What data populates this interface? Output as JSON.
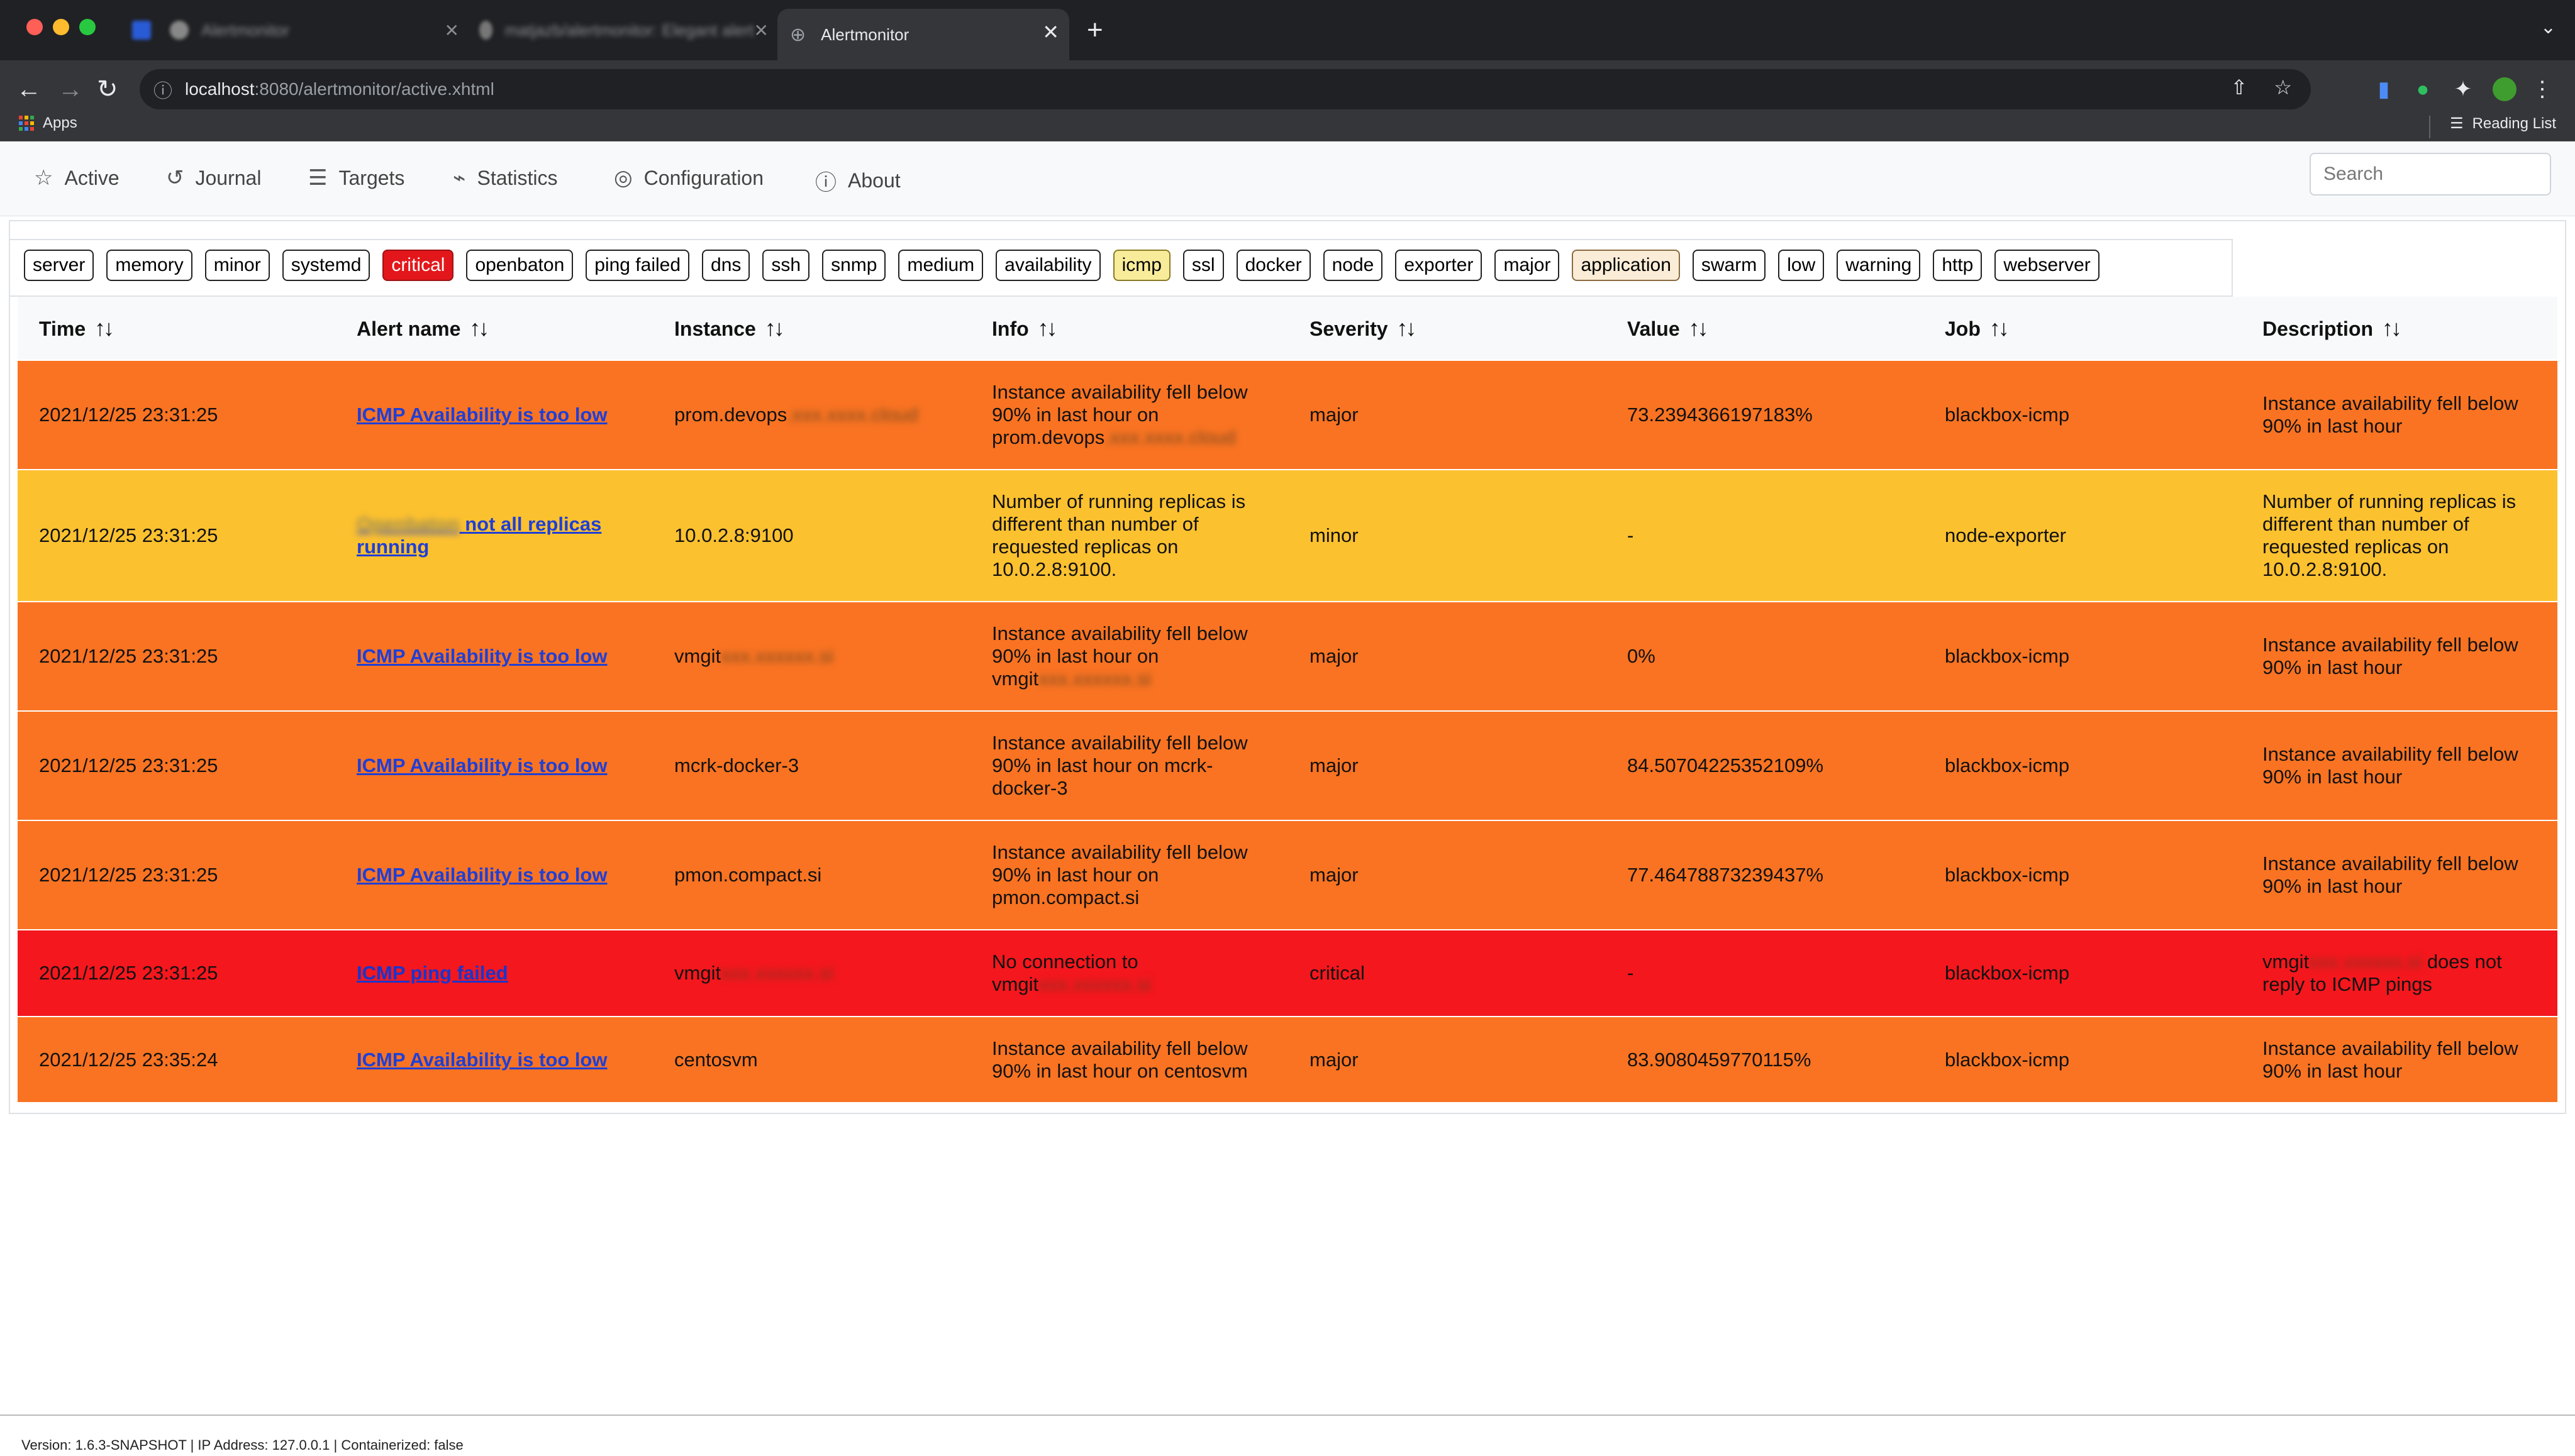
{
  "browser": {
    "tabs": [
      {
        "title": "Alertmonitor",
        "active": false,
        "blurred": true
      },
      {
        "title": "matjazb/alertmonitor: Elegant alert",
        "active": false,
        "blurred": true
      },
      {
        "title": "Alertmonitor",
        "active": true,
        "blurred": false
      }
    ],
    "url_host": "localhost",
    "url_path": ":8080/alertmonitor/active.xhtml",
    "bookmarks": {
      "apps_label": "Apps",
      "reading_list_label": "Reading List"
    }
  },
  "nav": {
    "items": [
      {
        "label": "Active",
        "icon": "star-icon"
      },
      {
        "label": "Journal",
        "icon": "history-icon"
      },
      {
        "label": "Targets",
        "icon": "list-icon"
      },
      {
        "label": "Statistics",
        "icon": "chart-icon"
      },
      {
        "label": "Configuration",
        "icon": "check-circle-icon"
      },
      {
        "label": "About",
        "icon": "info-icon"
      }
    ],
    "search_placeholder": "Search"
  },
  "tags": [
    "server",
    "memory",
    "minor",
    "systemd",
    "critical",
    "openbaton",
    "ping failed",
    "dns",
    "ssh",
    "snmp",
    "medium",
    "availability",
    "icmp",
    "ssl",
    "docker",
    "node",
    "exporter",
    "major",
    "application",
    "swarm",
    "low",
    "warning",
    "http",
    "webserver"
  ],
  "table": {
    "headers": [
      "Time",
      "Alert name",
      "Instance",
      "Info",
      "Severity",
      "Value",
      "Job",
      "Description"
    ],
    "rows": [
      {
        "time": "2021/12/25 23:31:25",
        "alert": "ICMP Availability is too low",
        "alert_blur": "",
        "instance": "prom.devops",
        "instance_blur": ".xxx.xxxx.cloud",
        "info": "Instance availability fell below 90% in last hour on prom.devops",
        "info_blur": ".xxx.xxxx.cloud",
        "severity": "major",
        "value": "73.2394366197183%",
        "job": "blackbox-icmp",
        "desc": "Instance availability fell below 90% in last hour",
        "desc_blur": "",
        "desc_tail": ""
      },
      {
        "time": "2021/12/25 23:31:25",
        "alert": "not all replicas running",
        "alert_blur": "Openbaton",
        "instance": "10.0.2.8:9100",
        "instance_blur": "",
        "info": "Number of running replicas is different than number of requested replicas on 10.0.2.8:9100.",
        "info_blur": "",
        "severity": "minor",
        "value": "-",
        "job": "node-exporter",
        "desc": "Number of running replicas is different than number of requested replicas on 10.0.2.8:9100.",
        "desc_blur": "",
        "desc_tail": ""
      },
      {
        "time": "2021/12/25 23:31:25",
        "alert": "ICMP Availability is too low",
        "alert_blur": "",
        "instance": "vmgit",
        "instance_blur": "xxx.xxxxxx.si",
        "info": "Instance availability fell below 90% in last hour on vmgit",
        "info_blur": "xxx.xxxxxx.si",
        "severity": "major",
        "value": "0%",
        "job": "blackbox-icmp",
        "desc": "Instance availability fell below 90% in last hour",
        "desc_blur": "",
        "desc_tail": ""
      },
      {
        "time": "2021/12/25 23:31:25",
        "alert": "ICMP Availability is too low",
        "alert_blur": "",
        "instance": "mcrk-docker-3",
        "instance_blur": "",
        "info": "Instance availability fell below 90% in last hour on mcrk-docker-3",
        "info_blur": "",
        "severity": "major",
        "value": "84.50704225352109%",
        "job": "blackbox-icmp",
        "desc": "Instance availability fell below 90% in last hour",
        "desc_blur": "",
        "desc_tail": ""
      },
      {
        "time": "2021/12/25 23:31:25",
        "alert": "ICMP Availability is too low",
        "alert_blur": "",
        "instance": "pmon.compact.si",
        "instance_blur": "",
        "info": "Instance availability fell below 90% in last hour on pmon.compact.si",
        "info_blur": "",
        "severity": "major",
        "value": "77.46478873239437%",
        "job": "blackbox-icmp",
        "desc": "Instance availability fell below 90% in last hour",
        "desc_blur": "",
        "desc_tail": ""
      },
      {
        "time": "2021/12/25 23:31:25",
        "alert": "ICMP ping failed",
        "alert_blur": "",
        "instance": "vmgit",
        "instance_blur": "xxx.xxxxxx.si",
        "info": "No connection to vmgit",
        "info_blur": "xxx.xxxxxx.si",
        "severity": "critical",
        "value": "-",
        "job": "blackbox-icmp",
        "desc": "vmgit",
        "desc_blur": "xxx.xxxxxx.si",
        "desc_tail": " does not reply to ICMP pings"
      },
      {
        "time": "2021/12/25 23:35:24",
        "alert": "ICMP Availability is too low",
        "alert_blur": "",
        "instance": "centosvm",
        "instance_blur": "",
        "info": "Instance availability fell below 90% in last hour on centosvm",
        "info_blur": "",
        "severity": "major",
        "value": "83.9080459770115%",
        "job": "blackbox-icmp",
        "desc": "Instance availability fell below 90% in last hour",
        "desc_blur": "",
        "desc_tail": ""
      }
    ]
  },
  "footer": "Version: 1.6.3-SNAPSHOT | IP Address: 127.0.0.1 | Containerized: false",
  "colors": {
    "major": "#f97322",
    "minor": "#fcc12f",
    "critical": "#f4171d",
    "link": "#1f3fd6"
  }
}
